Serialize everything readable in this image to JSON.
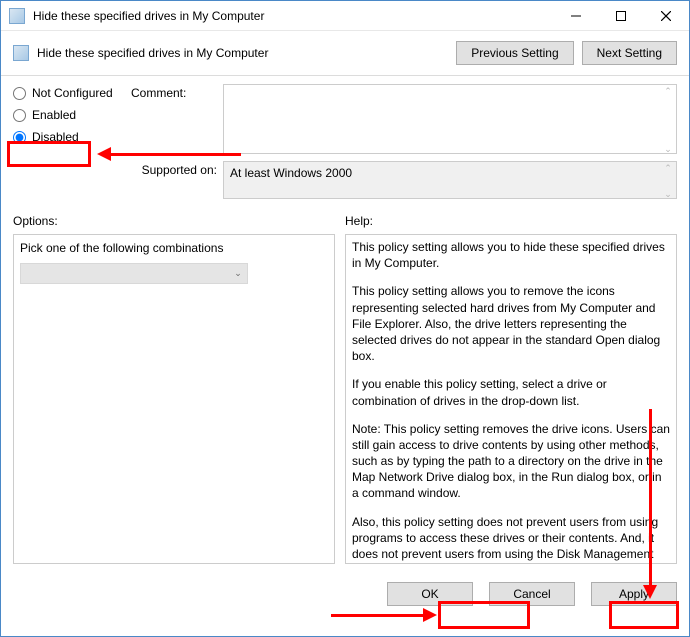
{
  "window": {
    "title": "Hide these specified drives in My Computer"
  },
  "header": {
    "title": "Hide these specified drives in My Computer",
    "prev_btn": "Previous Setting",
    "next_btn": "Next Setting"
  },
  "settings": {
    "comment_label": "Comment:",
    "comment_value": "",
    "supported_label": "Supported on:",
    "supported_value": "At least Windows 2000",
    "radios": {
      "not_configured": "Not Configured",
      "enabled": "Enabled",
      "disabled": "Disabled",
      "selected": "disabled"
    }
  },
  "options": {
    "label": "Options:",
    "text": "Pick one of the following combinations",
    "combo_value": ""
  },
  "help": {
    "label": "Help:",
    "p1": "This policy setting allows you to hide these specified drives in My Computer.",
    "p2": "This policy setting allows you to remove the icons representing selected hard drives from My Computer and File Explorer. Also, the drive letters representing the selected drives do not appear in the standard Open dialog box.",
    "p3": "If you enable this policy setting, select a drive or combination of drives in the drop-down list.",
    "p4": "Note: This policy setting removes the drive icons. Users can still gain access to drive contents by using other methods, such as by typing the path to a directory on the drive in the Map Network Drive dialog box, in the Run dialog box, or in a command window.",
    "p5": "Also, this policy setting does not prevent users from using programs to access these drives or their contents. And, it does not prevent users from using the Disk Management snap-in to view and change drive characteristics."
  },
  "footer": {
    "ok": "OK",
    "cancel": "Cancel",
    "apply": "Apply"
  }
}
